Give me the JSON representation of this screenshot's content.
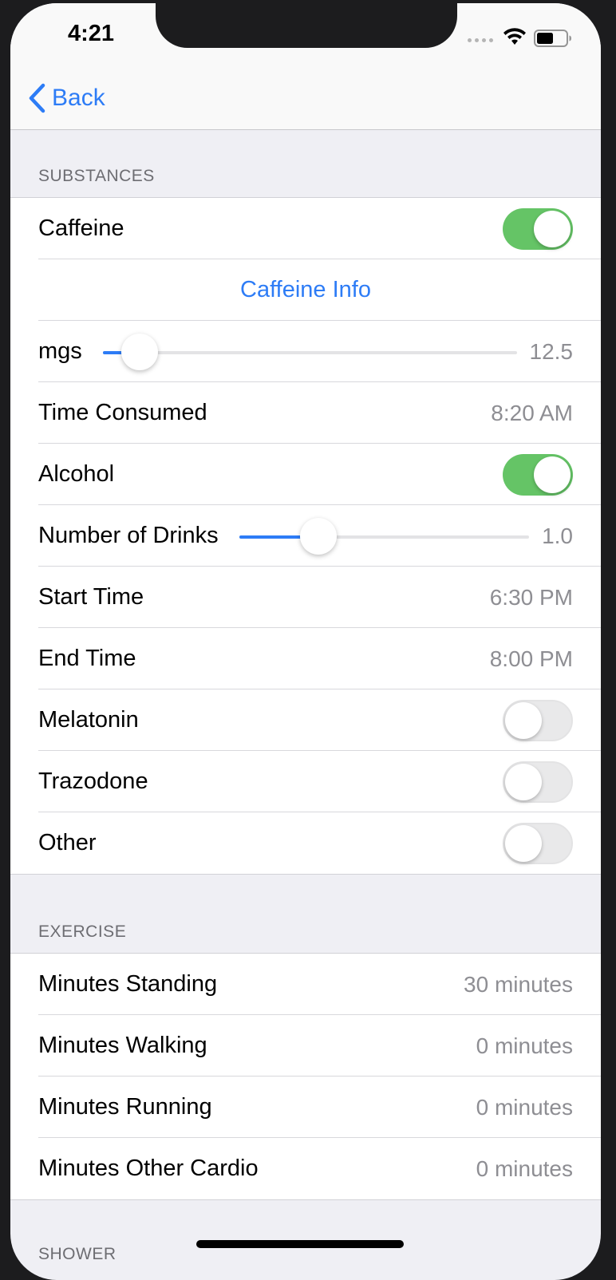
{
  "status_bar": {
    "time": "4:21"
  },
  "nav": {
    "back_label": "Back"
  },
  "substances": {
    "title": "SUBSTANCES",
    "caffeine": {
      "label": "Caffeine",
      "on": true
    },
    "caffeine_info": "Caffeine Info",
    "mgs": {
      "label": "mgs",
      "value": "12.5",
      "fraction": 0.05
    },
    "time_consumed": {
      "label": "Time Consumed",
      "value": "8:20 AM"
    },
    "alcohol": {
      "label": "Alcohol",
      "on": true
    },
    "drinks": {
      "label": "Number of Drinks",
      "value": "1.0",
      "fraction": 0.24
    },
    "start_time": {
      "label": "Start Time",
      "value": "6:30 PM"
    },
    "end_time": {
      "label": "End Time",
      "value": "8:00 PM"
    },
    "melatonin": {
      "label": "Melatonin",
      "on": false
    },
    "trazodone": {
      "label": "Trazodone",
      "on": false
    },
    "other": {
      "label": "Other",
      "on": false
    }
  },
  "exercise": {
    "title": "EXERCISE",
    "standing": {
      "label": "Minutes Standing",
      "value": "30 minutes"
    },
    "walking": {
      "label": "Minutes Walking",
      "value": "0 minutes"
    },
    "running": {
      "label": "Minutes Running",
      "value": "0 minutes"
    },
    "other_cardio": {
      "label": "Minutes Other Cardio",
      "value": "0 minutes"
    }
  },
  "next_section": {
    "title": "SHOWER"
  },
  "colors": {
    "accent": "#2d7cf6",
    "switch_on": "#65c466"
  },
  "icons": {
    "back": "chevron-left-icon",
    "wifi": "wifi-icon",
    "battery": "battery-icon",
    "signal": "cellular-signal-icon"
  }
}
